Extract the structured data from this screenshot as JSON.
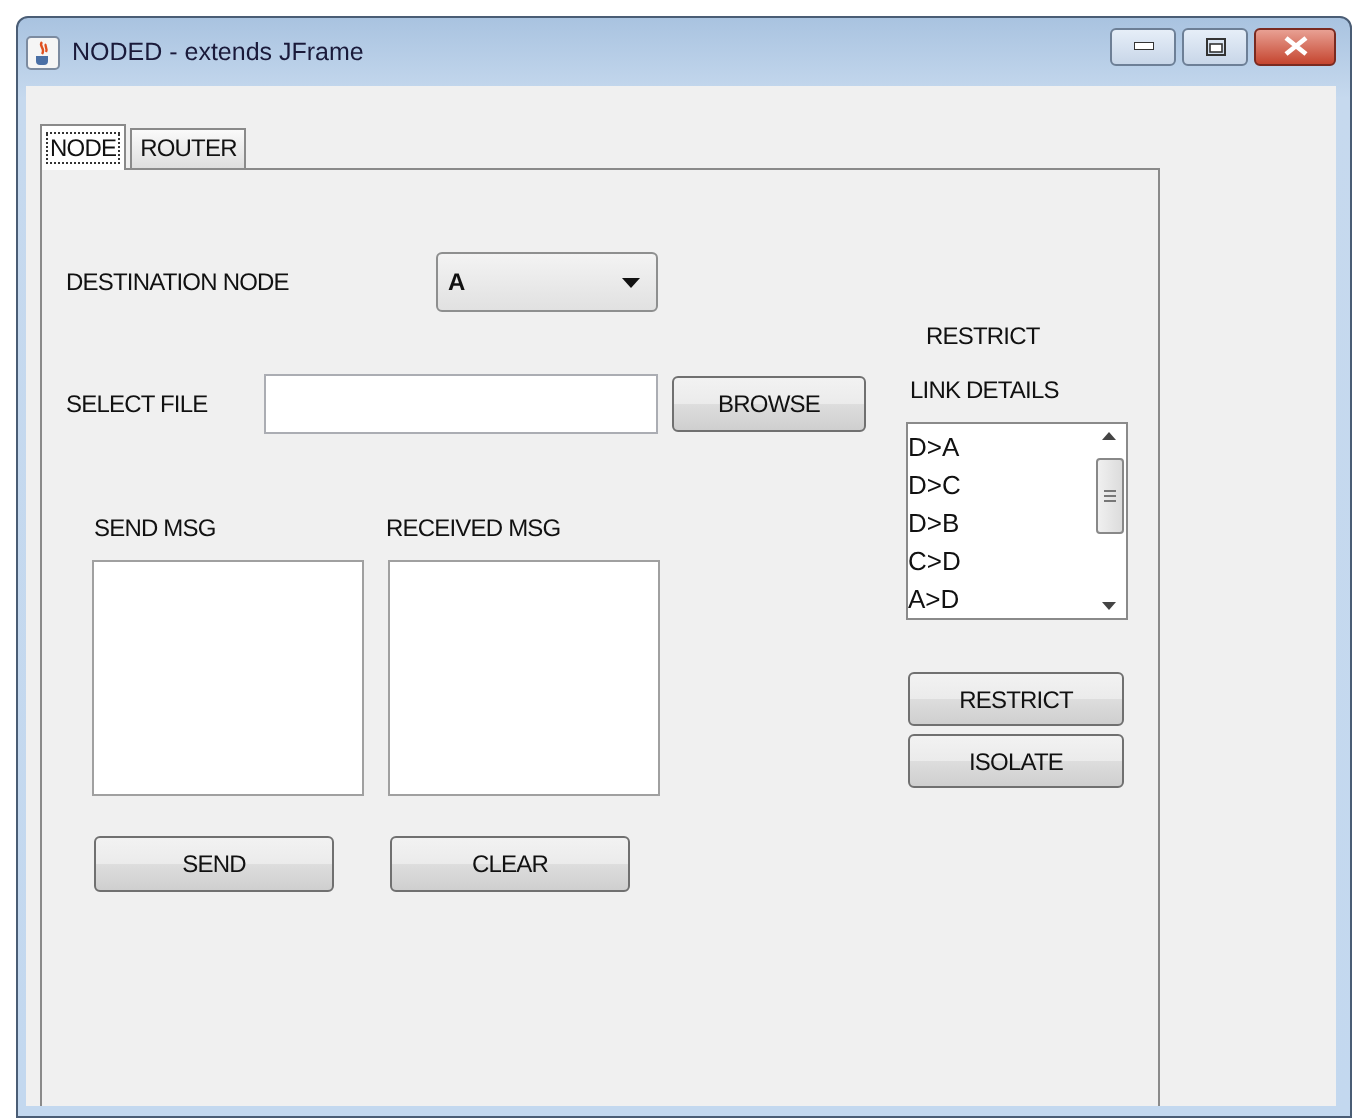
{
  "window": {
    "title": "NODED - extends JFrame"
  },
  "tabs": [
    {
      "label": "NODE",
      "selected": true
    },
    {
      "label": "ROUTER",
      "selected": false
    }
  ],
  "destination": {
    "label": "DESTINATION NODE",
    "value": "A"
  },
  "file": {
    "label": "SELECT FILE",
    "button": "BROWSE"
  },
  "messages": [
    {
      "label": "SEND MSG",
      "button": "SEND"
    },
    {
      "label": "RECEIVED MSG",
      "button": "CLEAR"
    }
  ],
  "restrict": {
    "title": "RESTRICT",
    "subtitle": "LINK DETAILS",
    "links": [
      "D>A",
      "D>C",
      "D>B",
      "C>D",
      "A>D"
    ],
    "buttons": [
      "RESTRICT",
      "ISOLATE"
    ]
  }
}
